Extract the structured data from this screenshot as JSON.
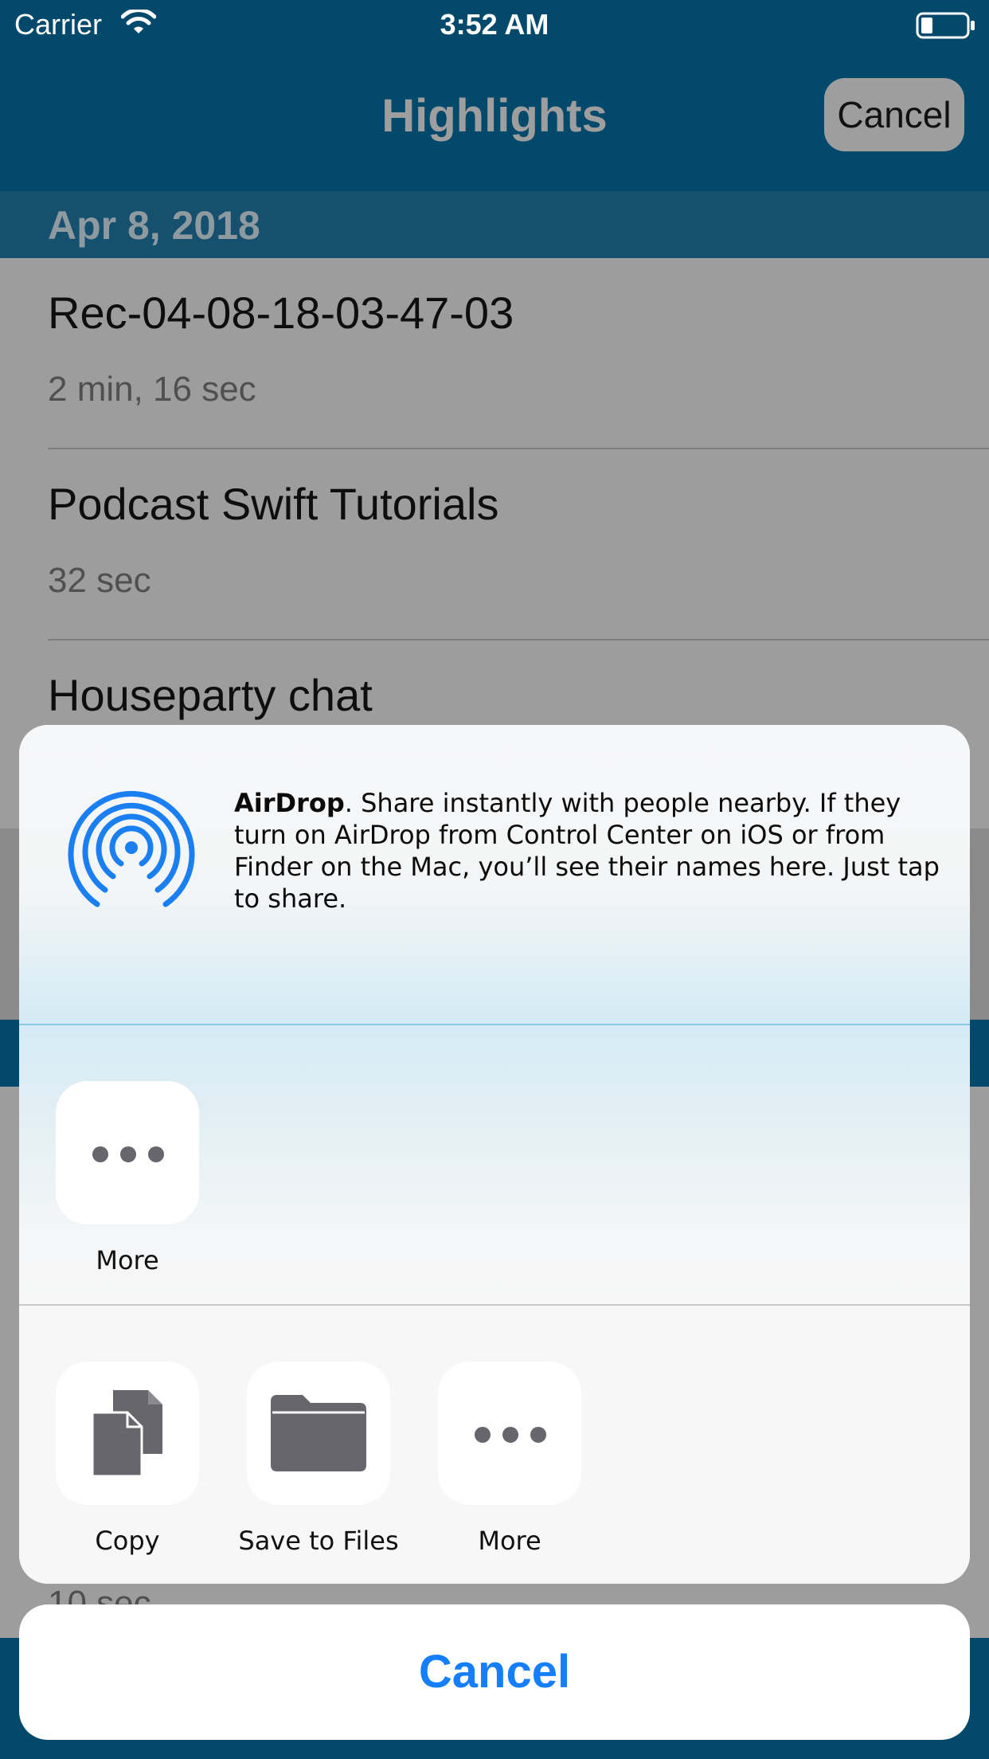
{
  "status_bar": {
    "carrier": "Carrier",
    "time": "3:52 AM"
  },
  "nav": {
    "title": "Highlights",
    "cancel_label": "Cancel"
  },
  "list": {
    "section_date": "Apr 8, 2018",
    "rows": [
      {
        "title": "Rec-04-08-18-03-47-03",
        "duration": "2 min, 16 sec"
      },
      {
        "title": "Podcast Swift Tutorials",
        "duration": "32 sec"
      },
      {
        "title": "Houseparty chat",
        "duration": ""
      }
    ],
    "peek_text": "10 sec"
  },
  "share_sheet": {
    "airdrop": {
      "title": "AirDrop",
      "description": ". Share instantly with people nearby. If they turn on AirDrop from Control Center on iOS or from Finder on the Mac, you’ll see their names here. Just tap to share."
    },
    "apps": [
      {
        "label": "More",
        "icon": "more-icon"
      }
    ],
    "actions": [
      {
        "label": "Copy",
        "icon": "copy-icon"
      },
      {
        "label": "Save to Files",
        "icon": "folder-icon"
      },
      {
        "label": "More",
        "icon": "more-icon"
      }
    ],
    "cancel_label": "Cancel"
  },
  "colors": {
    "nav_bar": "#03496b",
    "accent": "#147efb",
    "airdrop_blue": "#1a7ff3"
  }
}
